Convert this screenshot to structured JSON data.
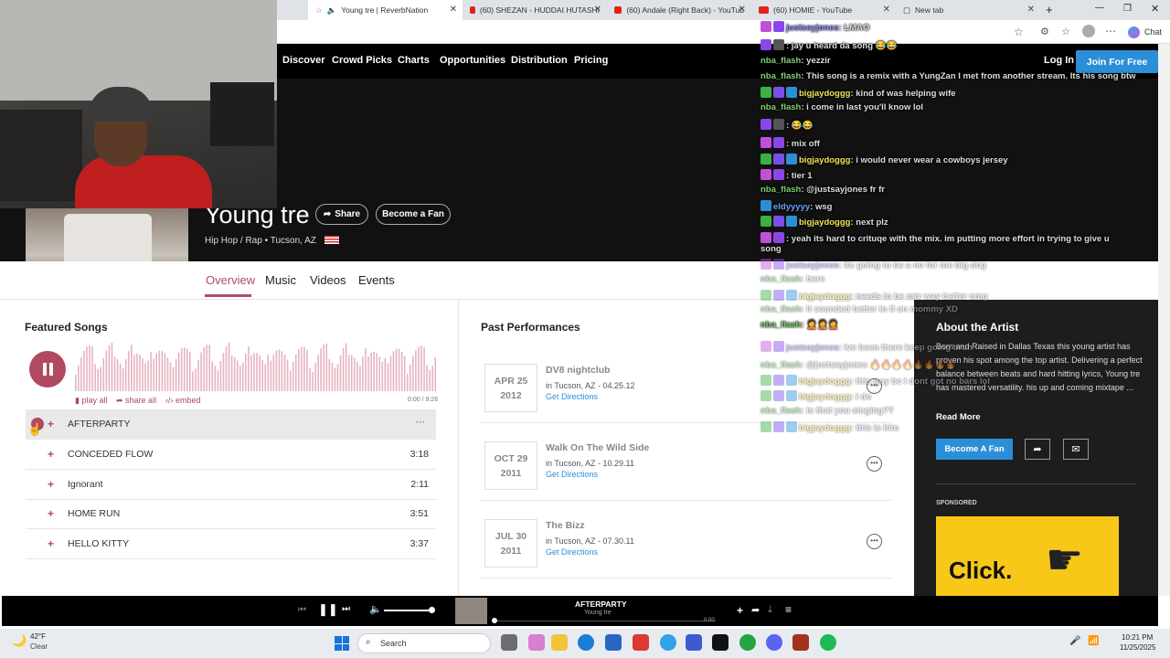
{
  "browser": {
    "tabs": [
      {
        "label": "Young tre | ReverbNation"
      },
      {
        "label": "(60) SHEZAN - HUDDAI HUTASHI"
      },
      {
        "label": "(60) Andale (Right Back) - YouTub"
      },
      {
        "label": "(60) HOMIE - YouTube"
      },
      {
        "label": "New tab"
      }
    ],
    "chat_label": "Chat"
  },
  "nav": {
    "items": [
      "Discover",
      "Crowd Picks",
      "Charts",
      "Opportunities",
      "Distribution",
      "Pricing"
    ],
    "login": "Log In",
    "join": "Join For Free"
  },
  "artist": {
    "name": "Young tre",
    "share": "Share",
    "become_fan": "Become a Fan",
    "genre": "Hip Hop / Rap",
    "location": "Tucson, AZ"
  },
  "subnav": {
    "tabs": [
      "Overview",
      "Music",
      "Videos",
      "Events"
    ]
  },
  "featured": {
    "title": "Featured Songs",
    "play_all": "play all",
    "share_all": "share all",
    "embed": "embed",
    "time": "0:00 / 9:26",
    "songs": [
      {
        "title": "AFTERPARTY",
        "duration": ""
      },
      {
        "title": "CONCEDED FLOW",
        "duration": "3:18"
      },
      {
        "title": "Ignorant",
        "duration": "2:11"
      },
      {
        "title": "HOME RUN",
        "duration": "3:51"
      },
      {
        "title": "HELLO KITTY",
        "duration": "3:37"
      }
    ]
  },
  "performances": {
    "title": "Past Performances",
    "items": [
      {
        "month": "APR 25",
        "year": "2012",
        "venue": "DV8 nightclub",
        "loc": "in Tucson, AZ - 04.25.12",
        "dir": "Get Directions"
      },
      {
        "month": "OCT 29",
        "year": "2011",
        "venue": "Walk On The Wild Side",
        "loc": "in Tucson, AZ - 10.29.11",
        "dir": "Get Directions"
      },
      {
        "month": "JUL 30",
        "year": "2011",
        "venue": "The Bizz",
        "loc": "in Tucson, AZ - 07.30.11",
        "dir": "Get Directions"
      }
    ]
  },
  "about": {
    "title": "About the Artist",
    "text": "Born and Raised in Dallas Texas this young artist has proven his spot among the top artist. Delivering a perfect balance between beats and hard hitting lyrics, Young tre has mastered versatility. his up and coming mixtape ...",
    "read_more": "Read More",
    "become_fan": "Become A Fan",
    "sponsored": "SPONSORED",
    "ad_text": "Click."
  },
  "chat": [
    {
      "user": "justsayjones",
      "msg": ": LMAO"
    },
    {
      "user": "",
      "msg": ": jay u heard da song 😂😂"
    },
    {
      "user": "nba_flash",
      "msg": ": yezzir"
    },
    {
      "user": "nba_flash",
      "msg": ": This song is a remix with a YungZan I met from another stream. Its his song btw"
    },
    {
      "user": "bigjaydoggg",
      "msg": ": kind of was helping wife"
    },
    {
      "user": "nba_flash",
      "msg": ": i come in last you'll know lol"
    },
    {
      "user": "",
      "msg": ": 😂😂"
    },
    {
      "user": "",
      "msg": ": mix off"
    },
    {
      "user": "bigjaydoggg",
      "msg": ": i would never wear a cowboys jersey"
    },
    {
      "user": "",
      "msg": ": tier 1"
    },
    {
      "user": "nba_flash",
      "msg": ": @justsayjones fr fr"
    },
    {
      "user": "eldyyyyy",
      "msg": ": wsg"
    },
    {
      "user": "bigjaydoggg",
      "msg": ": next plz"
    },
    {
      "user": "",
      "msg": ": yeah its hard to crituqe with the mix. im putting more effort in trying to give u"
    },
    {
      "user": "",
      "msg": "song"
    },
    {
      "user": "justsayjones",
      "msg": ": its going to be a no for me big dog"
    },
    {
      "user": "nba_flash",
      "msg": ": here"
    },
    {
      "user": "bigjaydoggg",
      "msg": ": needs to be mix way better omg"
    },
    {
      "user": "nba_flash",
      "msg": ": it sounded better in fl on mommy XD"
    },
    {
      "user": "nba_flash",
      "msg": ": 🤦🤦🤦"
    },
    {
      "user": "justsayjones",
      "msg": ": ive been there keep going bruh"
    },
    {
      "user": "nba_flash",
      "msg": ": @justsayjones 🔥🔥🔥🔥🔥🔥🔥🔥"
    },
    {
      "user": "bigjaydoggg",
      "msg": ": this guy bc i dont got no bars lol"
    },
    {
      "user": "bigjaydoggg",
      "msg": ": i do"
    },
    {
      "user": "nba_flash",
      "msg": ": is that you singing??"
    },
    {
      "user": "bigjaydoggg",
      "msg": ": this is him"
    }
  ],
  "player": {
    "title": "AFTERPARTY",
    "artist": "Young tre",
    "time": "0:00"
  },
  "taskbar": {
    "temp": "42°F",
    "weather": "Clear",
    "search": "Search",
    "time": "10:21 PM",
    "date": "11/25/2025"
  },
  "colors": {
    "accent": "#b24962",
    "blue": "#2b8fd8"
  }
}
